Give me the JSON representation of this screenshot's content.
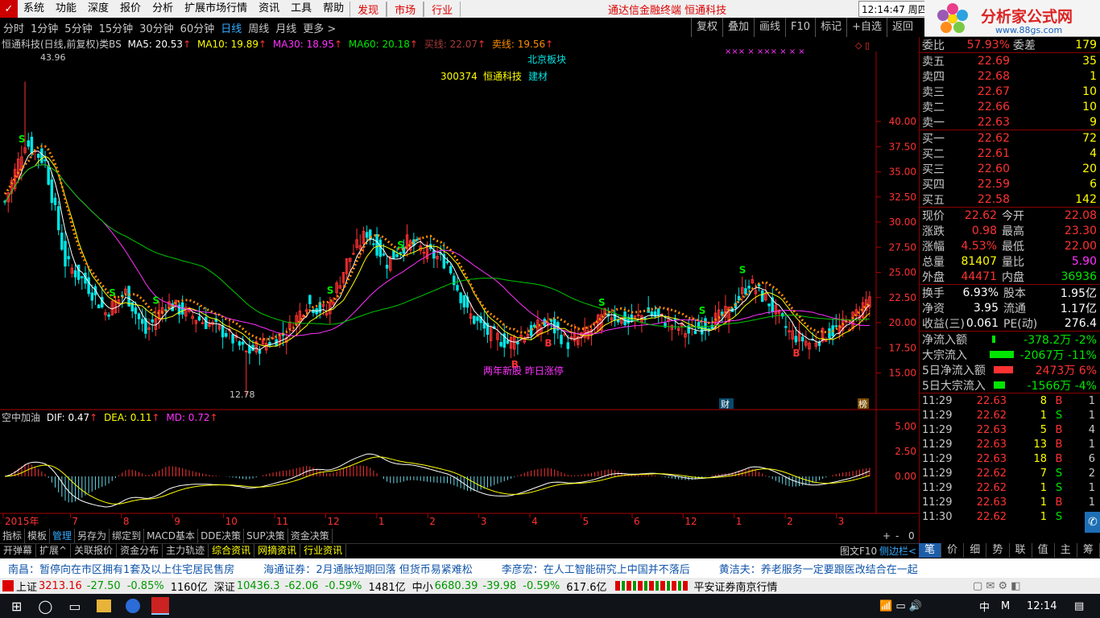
{
  "menubar": {
    "items": [
      "系统",
      "功能",
      "深度",
      "报价",
      "分析",
      "扩展市场行情",
      "资讯",
      "工具",
      "帮助"
    ],
    "highlights": [
      "发现",
      "市场",
      "行业"
    ],
    "title": "通达信金融终端  恒通科技",
    "clock": "12:14:47 周四",
    "partial": "行"
  },
  "watermark": {
    "name": "分析家公式网",
    "url": "www.88gs.com",
    "ghost": "300374 恒通科技"
  },
  "periods": [
    "分时",
    "1分钟",
    "5分钟",
    "15分钟",
    "30分钟",
    "60分钟",
    "日线",
    "周线",
    "月线",
    "更多 >"
  ],
  "active_period": "日线",
  "toolbar": [
    "复权",
    "叠加",
    "画线",
    "F10",
    "标记",
    "+自选",
    "返回"
  ],
  "legend": {
    "name": "恒通科技(日线,前复权)类BS",
    "ma5": "MA5: 20.53",
    "ma10": "MA10: 19.89",
    "ma30": "MA30: 18.95",
    "ma60": "MA60: 20.18",
    "buy": "买线: 22.07",
    "sell": "卖线: 19.56"
  },
  "annotations": {
    "block": "北京板块",
    "code": "300374",
    "stock": "恒通科技",
    "sector": "建材",
    "note": "两年新股 昨日涨停",
    "high": "43.96",
    "low": "12.78",
    "cai": "财",
    "bang": "榜"
  },
  "price_axis": [
    "40.00",
    "37.50",
    "35.00",
    "32.50",
    "30.00",
    "27.50",
    "25.00",
    "22.50",
    "20.00",
    "17.50",
    "15.00"
  ],
  "macd_legend": {
    "name": "空中加油",
    "dif": "DIF: 0.47",
    "dea": "DEA: 0.11",
    "md": "MD: 0.72"
  },
  "macd_axis": [
    "5.00",
    "2.50",
    "0.00"
  ],
  "date_axis": [
    "2015年",
    "7",
    "8",
    "9",
    "10",
    "11",
    "12",
    "1",
    "2",
    "3",
    "4",
    "5",
    "6",
    "12",
    "1",
    "2",
    "3"
  ],
  "chart_data": {
    "type": "candlestick",
    "title": "恒通科技(日线,前复权)",
    "ylim": [
      12.0,
      46.0
    ],
    "high": 43.96,
    "low": 12.78,
    "path_keypoints": [
      [
        0,
        32
      ],
      [
        6,
        38
      ],
      [
        12,
        36
      ],
      [
        18,
        26
      ],
      [
        24,
        24
      ],
      [
        30,
        21
      ],
      [
        36,
        23
      ],
      [
        42,
        19
      ],
      [
        48,
        22
      ],
      [
        54,
        21
      ],
      [
        60,
        20
      ],
      [
        66,
        19
      ],
      [
        72,
        17
      ],
      [
        78,
        18
      ],
      [
        84,
        19
      ],
      [
        90,
        22
      ],
      [
        96,
        21
      ],
      [
        102,
        26
      ],
      [
        108,
        29
      ],
      [
        114,
        26
      ],
      [
        120,
        28
      ],
      [
        126,
        27
      ],
      [
        132,
        26
      ],
      [
        138,
        21
      ],
      [
        144,
        19
      ],
      [
        150,
        18
      ],
      [
        156,
        19
      ],
      [
        162,
        20
      ],
      [
        168,
        18
      ],
      [
        174,
        19
      ],
      [
        180,
        21
      ],
      [
        186,
        20
      ],
      [
        192,
        21
      ],
      [
        198,
        20
      ],
      [
        204,
        19
      ],
      [
        210,
        20
      ],
      [
        216,
        21
      ],
      [
        222,
        24
      ],
      [
        228,
        22
      ],
      [
        234,
        19
      ],
      [
        240,
        18
      ],
      [
        246,
        19
      ],
      [
        252,
        20
      ],
      [
        258,
        22.6
      ]
    ]
  },
  "order_book": {
    "header": {
      "a": "委比",
      "b": "57.93%",
      "c": "委差",
      "d": "179"
    },
    "sells": [
      {
        "l": "卖五",
        "p": "22.69",
        "v": "35"
      },
      {
        "l": "卖四",
        "p": "22.68",
        "v": "1"
      },
      {
        "l": "卖三",
        "p": "22.67",
        "v": "10"
      },
      {
        "l": "卖二",
        "p": "22.66",
        "v": "10"
      },
      {
        "l": "卖一",
        "p": "22.63",
        "v": "9"
      }
    ],
    "buys": [
      {
        "l": "买一",
        "p": "22.62",
        "v": "72"
      },
      {
        "l": "买二",
        "p": "22.61",
        "v": "4"
      },
      {
        "l": "买三",
        "p": "22.60",
        "v": "20"
      },
      {
        "l": "买四",
        "p": "22.59",
        "v": "6"
      },
      {
        "l": "买五",
        "p": "22.58",
        "v": "142"
      }
    ]
  },
  "stats": [
    {
      "a": "现价",
      "b": "22.62",
      "c": "今开",
      "d": "22.08"
    },
    {
      "a": "涨跌",
      "b": "0.98",
      "c": "最高",
      "d": "23.30"
    },
    {
      "a": "涨幅",
      "b": "4.53%",
      "c": "最低",
      "d": "22.00"
    },
    {
      "a": "总量",
      "b": "81407",
      "c": "量比",
      "d": "5.90"
    },
    {
      "a": "外盘",
      "b": "44471",
      "c": "内盘",
      "d": "36936"
    }
  ],
  "stats2": [
    {
      "a": "换手",
      "b": "6.93%",
      "c": "股本",
      "d": "1.95亿"
    },
    {
      "a": "净资",
      "b": "3.95",
      "c": "流通",
      "d": "1.17亿"
    },
    {
      "a": "收益(三)",
      "b": "0.061",
      "c": "PE(动)",
      "d": "276.4"
    }
  ],
  "flows": [
    {
      "a": "净流入额",
      "d": "-378.2万  -2%"
    },
    {
      "a": "大宗流入",
      "d": "-2067万  -11%"
    },
    {
      "a": "5日净流入额",
      "d": "2473万   6%"
    },
    {
      "a": "5日大宗流入",
      "d": "-1566万  -4%"
    }
  ],
  "ticks": [
    {
      "t": "11:29",
      "p": "22.63",
      "v": "8",
      "s": "B",
      "n": "1"
    },
    {
      "t": "11:29",
      "p": "22.62",
      "v": "1",
      "s": "S",
      "n": "1"
    },
    {
      "t": "11:29",
      "p": "22.63",
      "v": "5",
      "s": "B",
      "n": "4"
    },
    {
      "t": "11:29",
      "p": "22.63",
      "v": "13",
      "s": "B",
      "n": "1"
    },
    {
      "t": "11:29",
      "p": "22.63",
      "v": "18",
      "s": "B",
      "n": "6"
    },
    {
      "t": "11:29",
      "p": "22.62",
      "v": "7",
      "s": "S",
      "n": "2"
    },
    {
      "t": "11:29",
      "p": "22.62",
      "v": "1",
      "s": "S",
      "n": "1"
    },
    {
      "t": "11:29",
      "p": "22.63",
      "v": "1",
      "s": "B",
      "n": "1"
    },
    {
      "t": "11:30",
      "p": "22.62",
      "v": "1",
      "s": "S",
      "n": "1"
    }
  ],
  "bottom_tabs": [
    "指标",
    "模板",
    "管理",
    "另存为",
    "绑定到",
    "MACD基本",
    "DDE决策",
    "SUP决策",
    "资金决策"
  ],
  "bottom_tabs2": [
    "开弹幕",
    "扩展^",
    "关联报价",
    "资金分布",
    "主力轨迹",
    "综合资讯",
    "网摘资讯",
    "行业资讯"
  ],
  "bottom_right": [
    "图文F10",
    "侧边栏<"
  ],
  "zoom_controls": [
    "+",
    "-",
    "0"
  ],
  "right_tabs": [
    "笔",
    "价",
    "细",
    "势",
    "联",
    "值",
    "主",
    "筹"
  ],
  "news": [
    {
      "n": "南昌：",
      "t": "暂停向在市区拥有1套及以上住宅居民售房"
    },
    {
      "n": "海通证券：",
      "t": "2月通胀短期回落 但货币易紧难松"
    },
    {
      "n": "李彦宏：",
      "t": "在人工智能研究上中国并不落后"
    },
    {
      "n": "黄洁夫：",
      "t": "养老服务一定要跟医改结合在一起"
    }
  ],
  "status": {
    "sh_name": "上证",
    "sh": "3213.16",
    "sh_chg": "-27.50",
    "sh_pct": "-0.85%",
    "sh_amt": "1160亿",
    "sz_name": "深证",
    "sz": "10436.3",
    "sz_chg": "-62.06",
    "sz_pct": "-0.59%",
    "sz_amt": "1481亿",
    "zx_name": "中小",
    "zx": "6680.39",
    "zx_chg": "-39.98",
    "zx_pct": "-0.59%",
    "zx_amt": "617.6亿",
    "broker": "平安证券南京行情"
  },
  "taskbar": {
    "time": "12:14",
    "lang": "中",
    "ime": "M"
  },
  "colors": {
    "up": "#ff3232",
    "down": "#00e5e5",
    "ma5": "#ffffff",
    "ma10": "#ffff00",
    "ma30": "#ff32ff",
    "ma60": "#00c800",
    "buyline": "#ff8c00"
  }
}
